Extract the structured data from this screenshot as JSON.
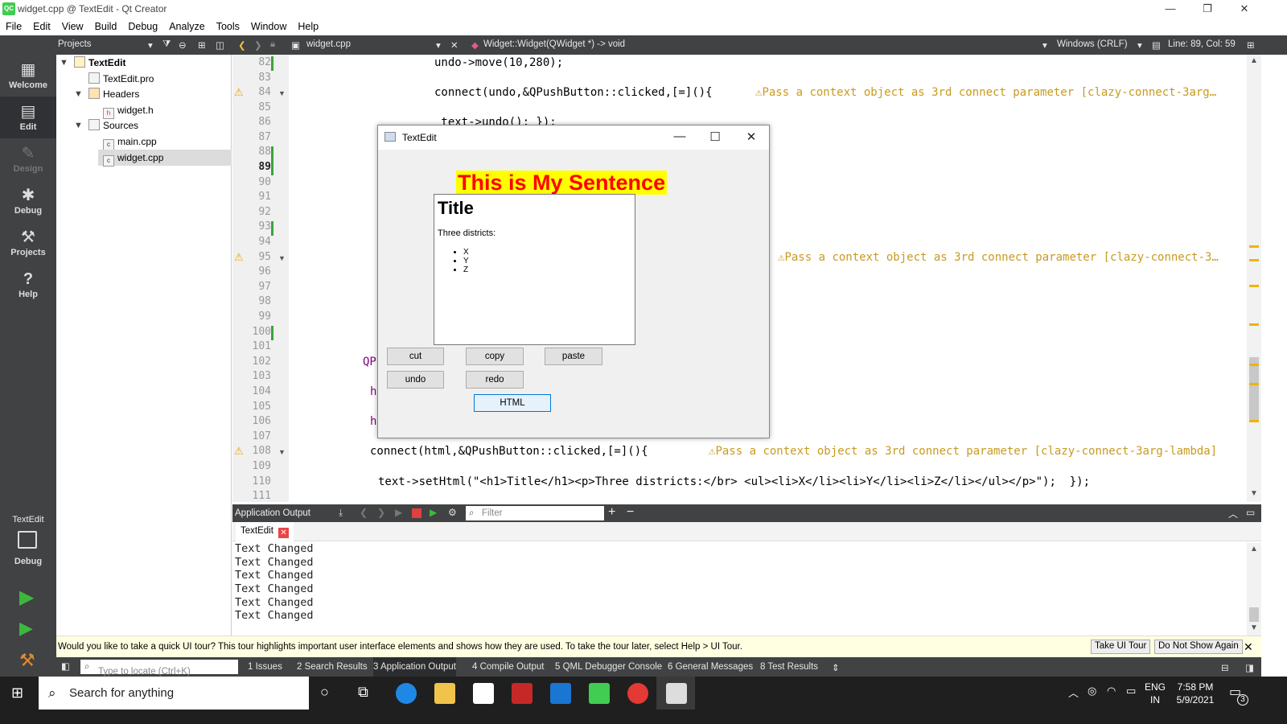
{
  "window": {
    "title": "widget.cpp @ TextEdit - Qt Creator",
    "logo": "QC"
  },
  "menu": [
    "File",
    "Edit",
    "View",
    "Build",
    "Debug",
    "Analyze",
    "Tools",
    "Window",
    "Help"
  ],
  "toolbar": {
    "projects_label": "Projects",
    "file_tab": "widget.cpp",
    "function": "Widget::Widget(QWidget *) -> void",
    "line_ending": "Windows (CRLF)",
    "position": "Line: 89, Col: 59"
  },
  "modes": [
    {
      "label": "Welcome",
      "icon": "grid-icon"
    },
    {
      "label": "Edit",
      "icon": "edit-icon"
    },
    {
      "label": "Design",
      "icon": "pen-icon"
    },
    {
      "label": "Debug",
      "icon": "bug-icon"
    },
    {
      "label": "Projects",
      "icon": "wrench-icon"
    },
    {
      "label": "Help",
      "icon": "help-icon"
    }
  ],
  "kit": {
    "project": "TextEdit",
    "mode": "Debug"
  },
  "tree": {
    "root": "TextEdit",
    "pro": "TextEdit.pro",
    "headers": "Headers",
    "widget_h": "widget.h",
    "sources": "Sources",
    "main_cpp": "main.cpp",
    "widget_cpp": "widget.cpp"
  },
  "lines": [
    "82",
    "83",
    "84",
    "85",
    "86",
    "87",
    "88",
    "89",
    "90",
    "91",
    "92",
    "93",
    "94",
    "95",
    "96",
    "97",
    "98",
    "99",
    "100",
    "101",
    "102",
    "103",
    "104",
    "105",
    "106",
    "107",
    "108",
    "109",
    "110",
    "111"
  ],
  "code": {
    "l82": "undo->move(10,280);",
    "l84": "connect(undo,&QPushButton::clicked,[=](){",
    "l86": " text->undo(); });",
    "l102": "QP",
    "l104": "h",
    "l106": "h",
    "l108": "connect(html,&QPushButton::clicked,[=](){",
    "l110": "text->setHtml(\"<h1>Title</h1><p>Three districts:</br> <ul><li>X</li><li>Y</li><li>Z</li></ul></p>\");  });",
    "warn84": "Pass a context object as 3rd connect parameter [clazy-connect-3arg…",
    "warn95": "Pass a context object as 3rd connect parameter [clazy-connect-3…",
    "warn108": "Pass a context object as 3rd connect parameter [clazy-connect-3arg-lambda]"
  },
  "output": {
    "title": "Application Output",
    "filter_placeholder": "Filter",
    "tab": "TextEdit",
    "lines": [
      "Text Changed",
      "Text Changed",
      "Text Changed",
      "Text Changed",
      "Text Changed",
      "Text Changed"
    ]
  },
  "tour": {
    "message": "Would you like to take a quick UI tour? This tour highlights important user interface elements and shows how they are used. To take the tour later, select Help > UI Tour.",
    "take": "Take UI Tour",
    "dismiss": "Do Not Show Again"
  },
  "statusbar": {
    "locate_placeholder": "Type to locate (Ctrl+K)",
    "items": [
      "1  Issues",
      "2  Search Results",
      "3  Application Output",
      "4  Compile Output",
      "5  QML Debugger Console",
      "6  General Messages",
      "8  Test Results"
    ]
  },
  "dialog": {
    "title": "TextEdit",
    "sentence": "This is My Sentence",
    "doc_title": "Title",
    "doc_para": "Three districts:",
    "doc_items": [
      "X",
      "Y",
      "Z"
    ],
    "buttons": {
      "cut": "cut",
      "copy": "copy",
      "paste": "paste",
      "undo": "undo",
      "redo": "redo",
      "html": "HTML"
    }
  },
  "taskbar": {
    "search": "Search for anything",
    "lang": "ENG",
    "region": "IN",
    "time": "7:58 PM",
    "date": "5/9/2021",
    "notifications": "3"
  }
}
